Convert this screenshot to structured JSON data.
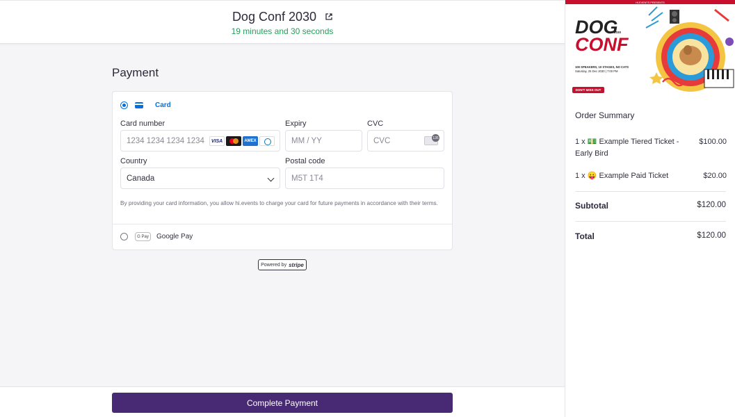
{
  "header": {
    "event_title": "Dog Conf 2030",
    "timer": "19 minutes and 30 seconds"
  },
  "payment": {
    "title": "Payment",
    "option_card_label": "Card",
    "card_number_label": "Card number",
    "card_number_placeholder": "1234 1234 1234 1234",
    "expiry_label": "Expiry",
    "expiry_placeholder": "MM / YY",
    "cvc_label": "CVC",
    "cvc_placeholder": "CVC",
    "country_label": "Country",
    "country_value": "Canada",
    "postal_label": "Postal code",
    "postal_placeholder": "M5T 1T4",
    "terms": "By providing your card information, you allow hi.events to charge your card for future payments in accordance with their terms.",
    "option_gpay_label": "Google Pay",
    "gpay_badge": "G Pay",
    "powered_by": "Powered by",
    "powered_brand": "stripe",
    "complete_button": "Complete Payment"
  },
  "banner": {
    "presents": "HI.EVENTS PRESENTS",
    "title_line1": "DOG",
    "title_line2": "CONF",
    "year": "2030",
    "tagline": "100 SPEAKERS, 10 STAGES, NO CATS",
    "date": "Saturday, 25 Dec 2030 | 7:00 PM",
    "cta": "DON'T MISS OUT"
  },
  "summary": {
    "title": "Order Summary",
    "items": [
      {
        "name": "1 x 💵 Example Tiered Ticket - Early Bird",
        "price": "$100.00"
      },
      {
        "name": "1 x 😛 Example Paid Ticket",
        "price": "$20.00"
      }
    ],
    "subtotal_label": "Subtotal",
    "subtotal_value": "$120.00",
    "total_label": "Total",
    "total_value": "$120.00"
  },
  "colors": {
    "accent": "#472a73",
    "timer": "#22a05a",
    "stripe_blue": "#0570de"
  }
}
